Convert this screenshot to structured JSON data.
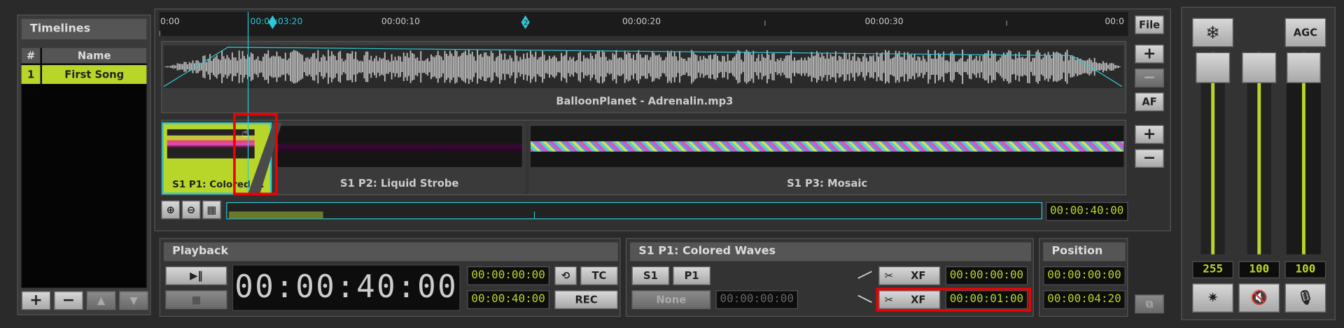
{
  "timelines": {
    "title": "Timelines",
    "col_num": "#",
    "col_name": "Name",
    "rows": [
      {
        "num": "1",
        "name": "First Song"
      }
    ],
    "buttons": {
      "add": "+",
      "remove": "−",
      "up": "▲",
      "down": "▼"
    }
  },
  "ruler": {
    "labels": [
      "0:00",
      "00:00:03:20",
      "00:00:10",
      "00:00:20",
      "00:00:30",
      "00:0"
    ],
    "marker_label": "2"
  },
  "audio": {
    "track_name": "BalloonPlanet - Adrenalin.mp3"
  },
  "clips": [
    {
      "label": "S1 P1: Colored ..."
    },
    {
      "label": "S1 P2: Liquid Strobe"
    },
    {
      "label": "S1 P3: Mosaic"
    }
  ],
  "side_buttons": {
    "file": "File",
    "plus": "+",
    "minus": "−",
    "af": "AF",
    "plus2": "+",
    "minus2": "−"
  },
  "scroll": {
    "duration": "00:00:40:00"
  },
  "playback": {
    "title": "Playback",
    "play_pause": "▶‖",
    "stop": "■",
    "big_time": "00:00:40:00",
    "time1": "00:00:00:00",
    "time2": "00:00:40:00",
    "tc_label": "TC",
    "rec_label": "REC"
  },
  "cue": {
    "title": "S1 P1: Colored Waves",
    "s_label": "S1",
    "p_label": "P1",
    "none_label": "None",
    "none_time": "00:00:00:00",
    "xf1_label": "XF",
    "xf1_time": "00:00:00:00",
    "xf2_label": "XF",
    "xf2_time": "00:00:01:00"
  },
  "position": {
    "title": "Position",
    "time1": "00:00:00:00",
    "time2": "00:00:04:20"
  },
  "mixer": {
    "agc_label": "AGC",
    "values": [
      "255",
      "100",
      "100"
    ],
    "levels": [
      1.0,
      1.0,
      1.0
    ]
  },
  "colors": {
    "accent": "#b8d629",
    "cyan": "#2ec7d6",
    "highlight": "#e00000"
  }
}
